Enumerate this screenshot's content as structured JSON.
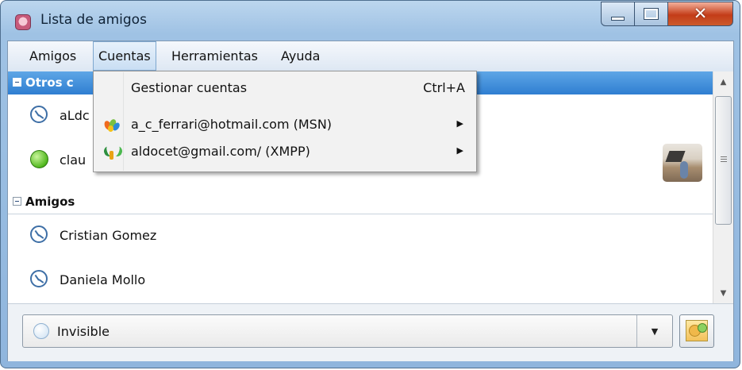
{
  "window": {
    "title": "Lista de amigos"
  },
  "menu": {
    "amigos": "Amigos",
    "cuentas": "Cuentas",
    "herramientas": "Herramientas",
    "ayuda": "Ayuda"
  },
  "groups": [
    {
      "name": "Otros c"
    },
    {
      "name": "Amigos"
    }
  ],
  "contacts": [
    {
      "name": "aLdc",
      "status": "away"
    },
    {
      "name": "clau",
      "status": "online"
    },
    {
      "name": "Cristian Gomez",
      "status": "away"
    },
    {
      "name": "Daniela Mollo",
      "status": "away"
    }
  ],
  "dropdown": {
    "items": [
      {
        "label": "Gestionar cuentas",
        "shortcut": "Ctrl+A"
      },
      {
        "label": "a_c_ferrari@hotmail.com (MSN)",
        "icon": "msn-butterfly-icon"
      },
      {
        "label": "aldocet@gmail.com/ (XMPP)",
        "icon": "xmpp-icon"
      }
    ]
  },
  "status_select": {
    "value": "Invisible"
  },
  "colors": {
    "selection": "#3a8bdb",
    "close_button": "#c8401a"
  }
}
